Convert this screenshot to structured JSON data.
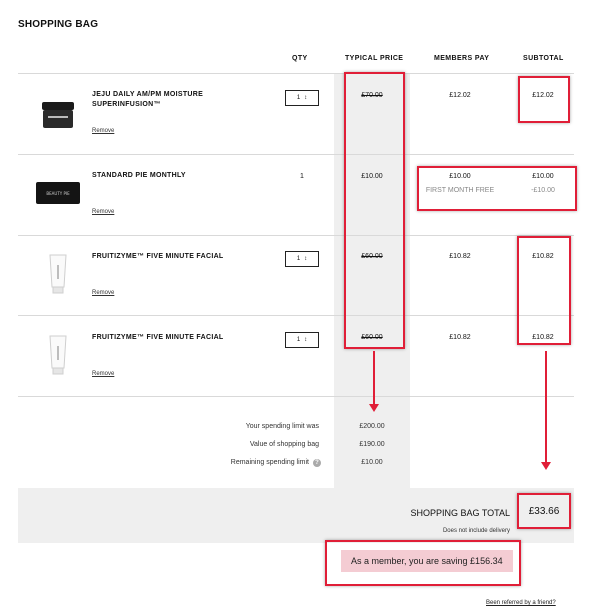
{
  "page": {
    "title": "SHOPPING BAG"
  },
  "columns": {
    "qty": "QTY",
    "typical": "TYPICAL PRICE",
    "members": "MEMBERS PAY",
    "subtotal": "SUBTOTAL"
  },
  "items": [
    {
      "name": "JEJU DAILY AM/PM MOISTURE SUPERINFUSION™",
      "remove": "Remove",
      "qty": "1",
      "typical": "£70.00",
      "members": "£12.02",
      "subtotal": "£12.02",
      "image": "jar-image"
    },
    {
      "name": "STANDARD PIE MONTHLY",
      "remove": "Remove",
      "qty": "1",
      "typical": "£10.00",
      "members": "£10.00",
      "subtotal": "£10.00",
      "note_label": "FIRST MONTH FREE",
      "note_value": "-£10.00",
      "image": "box-image"
    },
    {
      "name": "FRUITIZYME™ FIVE MINUTE FACIAL",
      "remove": "Remove",
      "qty": "1",
      "typical": "£60.00",
      "members": "£10.82",
      "subtotal": "£10.82",
      "image": "tube-image"
    },
    {
      "name": "FRUITIZYME™ FIVE MINUTE FACIAL",
      "remove": "Remove",
      "qty": "1",
      "typical": "£60.00",
      "members": "£10.82",
      "subtotal": "£10.82",
      "image": "tube-image"
    }
  ],
  "summary": {
    "limit_label": "Your spending limit was",
    "limit_value": "£200.00",
    "bag_label": "Value of shopping bag",
    "bag_value": "£190.00",
    "remaining_label": "Remaining spending limit",
    "remaining_value": "£10.00"
  },
  "total": {
    "label": "SHOPPING BAG TOTAL",
    "value": "£33.66",
    "delivery_note": "Does not include delivery"
  },
  "saving": {
    "text": "As a member, you are saving £156.34"
  },
  "referral": {
    "link": "Been referred by a friend?"
  },
  "qty_stepper_icon": "↕",
  "box_brand": "BEAUTY PIE",
  "colors": {
    "accent": "#e01e37",
    "shade": "#efefef",
    "saving_bg": "#f4ccd3"
  }
}
